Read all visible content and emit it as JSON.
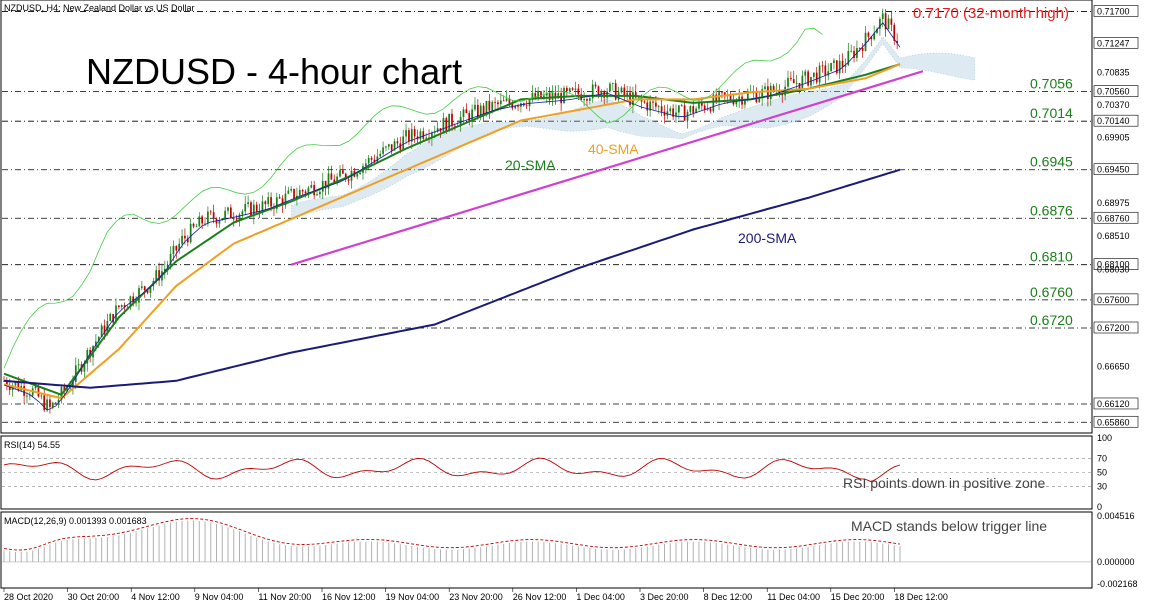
{
  "header": {
    "symbol_label": "NZDUSD, H4:  New Zealand Dollar vs US Dollar",
    "big_title": "NZDUSD - 4-hour chart"
  },
  "colors": {
    "background": "#ffffff",
    "candle_up": "#1a7f1a",
    "candle_down": "#c00000",
    "sma20": "#1a7f1a",
    "sma40": "#f0a020",
    "sma200": "#1a1a7a",
    "trendline": "#d040d0",
    "ichimoku_cloud": "#9fc4d8",
    "level_text": "#1a7f1a",
    "high_text": "#e02020",
    "rsi_line": "#c00000",
    "macd_hist": "#b0b0b0",
    "macd_signal": "#c00000",
    "tenkan": "#1a1aa0",
    "chikou": "#44cc44"
  },
  "annotations": {
    "high_label": "0.7170 (32-month high)",
    "sma20_label": "20-SMA",
    "sma40_label": "40-SMA",
    "sma200_label": "200-SMA",
    "rsi_note": "RSI points down in positive zone",
    "macd_note": "MACD stands below trigger line"
  },
  "levels": [
    {
      "value": "0.7170",
      "show_left": false
    },
    {
      "value": "0.7056",
      "show_left": true
    },
    {
      "value": "0.7014",
      "show_left": true
    },
    {
      "value": "0.6945",
      "show_left": true
    },
    {
      "value": "0.6876",
      "show_left": true
    },
    {
      "value": "0.6810",
      "show_left": true
    },
    {
      "value": "0.6760",
      "show_left": true
    },
    {
      "value": "0.6720",
      "show_left": true
    }
  ],
  "price_axis_labels": [
    {
      "value": 0.717,
      "text": "0.71700",
      "boxed": true
    },
    {
      "value": 0.71247,
      "text": "0.71247",
      "boxed": true
    },
    {
      "value": 0.70835,
      "text": "0.70835",
      "boxed": false
    },
    {
      "value": 0.7056,
      "text": "0.70560",
      "boxed": true
    },
    {
      "value": 0.7037,
      "text": "0.70370",
      "boxed": false
    },
    {
      "value": 0.7014,
      "text": "0.70140",
      "boxed": true
    },
    {
      "value": 0.69905,
      "text": "0.69905",
      "boxed": false
    },
    {
      "value": 0.6945,
      "text": "0.69450",
      "boxed": true
    },
    {
      "value": 0.68975,
      "text": "0.68975",
      "boxed": false
    },
    {
      "value": 0.6876,
      "text": "0.68760",
      "boxed": true
    },
    {
      "value": 0.6851,
      "text": "0.68510",
      "boxed": false
    },
    {
      "value": 0.681,
      "text": "0.68100",
      "boxed": true
    },
    {
      "value": 0.6803,
      "text": "0.68030",
      "boxed": false
    },
    {
      "value": 0.676,
      "text": "0.67600",
      "boxed": true
    },
    {
      "value": 0.672,
      "text": "0.67200",
      "boxed": true
    },
    {
      "value": 0.6665,
      "text": "0.66650",
      "boxed": false
    },
    {
      "value": 0.6612,
      "text": "0.66120",
      "boxed": true
    },
    {
      "value": 0.6586,
      "text": "0.65860",
      "boxed": true
    }
  ],
  "rsi": {
    "label": "RSI(14) 54.55",
    "levels": [
      "100",
      "70",
      "50",
      "30",
      "0"
    ],
    "current": 54.55
  },
  "macd": {
    "label": "MACD(12,26,9) 0.001393 0.001683",
    "axis_labels": [
      "0.004516",
      "0.000000",
      "-0.002168"
    ],
    "main": 0.001393,
    "signal": 0.001683
  },
  "chart_data": {
    "type": "candlestick",
    "symbol": "NZDUSD",
    "timeframe": "H4",
    "y_range": [
      0.6575,
      0.7182
    ],
    "x_tick_labels": [
      "28 Oct 2020",
      "30 Oct 20:00",
      "4 Nov 12:00",
      "9 Nov 04:00",
      "11 Nov 20:00",
      "16 Nov 12:00",
      "19 Nov 04:00",
      "23 Nov 20:00",
      "26 Nov 12:00",
      "1 Dec 04:00",
      "3 Dec 20:00",
      "8 Dec 12:00",
      "11 Dec 04:00",
      "15 Dec 20:00",
      "18 Dec 12:00"
    ],
    "close_path": [
      [
        0,
        0.6645
      ],
      [
        10,
        0.663
      ],
      [
        16,
        0.6605
      ],
      [
        22,
        0.6635
      ],
      [
        30,
        0.669
      ],
      [
        40,
        0.675
      ],
      [
        50,
        0.678
      ],
      [
        56,
        0.6805
      ],
      [
        62,
        0.6845
      ],
      [
        70,
        0.6875
      ],
      [
        82,
        0.6885
      ],
      [
        92,
        0.6895
      ],
      [
        104,
        0.6915
      ],
      [
        118,
        0.6935
      ],
      [
        130,
        0.6965
      ],
      [
        140,
        0.699
      ],
      [
        150,
        0.7005
      ],
      [
        160,
        0.702
      ],
      [
        170,
        0.7035
      ],
      [
        182,
        0.7045
      ],
      [
        196,
        0.705
      ],
      [
        210,
        0.706
      ],
      [
        222,
        0.704
      ],
      [
        236,
        0.7025
      ],
      [
        250,
        0.7045
      ],
      [
        266,
        0.7055
      ],
      [
        280,
        0.7075
      ],
      [
        292,
        0.7095
      ],
      [
        300,
        0.713
      ],
      [
        306,
        0.716
      ],
      [
        312,
        0.7125
      ]
    ],
    "series": [
      {
        "name": "20-SMA",
        "values": [
          [
            0,
            0.6655
          ],
          [
            20,
            0.6625
          ],
          [
            40,
            0.6735
          ],
          [
            60,
            0.6815
          ],
          [
            80,
            0.687
          ],
          [
            100,
            0.69
          ],
          [
            120,
            0.6935
          ],
          [
            140,
            0.6975
          ],
          [
            160,
            0.701
          ],
          [
            180,
            0.7045
          ],
          [
            200,
            0.705
          ],
          [
            220,
            0.705
          ],
          [
            240,
            0.704
          ],
          [
            260,
            0.7045
          ],
          [
            280,
            0.706
          ],
          [
            300,
            0.708
          ],
          [
            312,
            0.7095
          ]
        ]
      },
      {
        "name": "40-SMA",
        "values": [
          [
            0,
            0.664
          ],
          [
            20,
            0.662
          ],
          [
            40,
            0.669
          ],
          [
            60,
            0.678
          ],
          [
            80,
            0.684
          ],
          [
            100,
            0.6875
          ],
          [
            120,
            0.691
          ],
          [
            140,
            0.6945
          ],
          [
            160,
            0.698
          ],
          [
            180,
            0.7015
          ],
          [
            200,
            0.703
          ],
          [
            220,
            0.7045
          ],
          [
            240,
            0.7045
          ],
          [
            260,
            0.7055
          ],
          [
            280,
            0.706
          ],
          [
            300,
            0.7075
          ],
          [
            312,
            0.7095
          ]
        ]
      },
      {
        "name": "200-SMA",
        "values": [
          [
            0,
            0.6645
          ],
          [
            30,
            0.6635
          ],
          [
            60,
            0.6645
          ],
          [
            100,
            0.6685
          ],
          [
            150,
            0.6725
          ],
          [
            200,
            0.6805
          ],
          [
            240,
            0.686
          ],
          [
            280,
            0.6905
          ],
          [
            312,
            0.6945
          ]
        ]
      }
    ],
    "trendline": [
      [
        100,
        0.681
      ],
      [
        320,
        0.7085
      ]
    ],
    "xlabel": "",
    "ylabel": ""
  }
}
